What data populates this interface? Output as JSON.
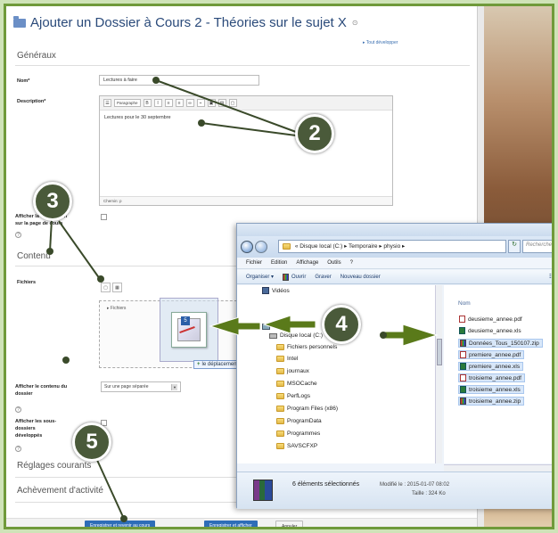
{
  "page": {
    "title": "Ajouter un Dossier à Cours 2 - Théories sur le sujet X",
    "expand_all": "▸ Tout développer",
    "section_general": "Généraux",
    "section_content": "Contenu",
    "section_restrictions": "Réglages courants",
    "section_completion": "Achèvement d'activité"
  },
  "form": {
    "name_label": "Nom*",
    "name_value": "Lectures à faire",
    "description_label": "Description*",
    "editor_paragraph": "Paragraphe",
    "description_value": "Lectures pour le 30 septembre",
    "editor_path": "Chemin: p",
    "show_description_label": "Afficher la description sur la page de cours",
    "files_label": "Fichiers",
    "files_tree": "▸ Fichiers",
    "display_label": "Afficher le contenu du dossier",
    "display_value": "Sur une page séparée",
    "expand_sub_label": "Afficher les sous-dossiers développés"
  },
  "drag": {
    "tooltip": "le déplacement",
    "badge": "5"
  },
  "buttons": {
    "save_return": "Enregistrer et revenir au cours",
    "save_display": "Enregistrer et afficher",
    "cancel": "Annuler"
  },
  "explorer": {
    "path": "« Disque local (C:) ▸ Temporaire ▸ physio ▸",
    "search_placeholder": "Rechercher",
    "menu": [
      "Fichier",
      "Edition",
      "Affichage",
      "Outils",
      "?"
    ],
    "commands": [
      "Organiser ▾",
      "Ouvrir",
      "Graver",
      "Nouveau dossier"
    ],
    "column_name": "Nom",
    "nav_items": [
      "Vidéos",
      "Ordinateur",
      "Disque local (C:)",
      "Fichiers personnels",
      "Intel",
      "journaux",
      "MSOCache",
      "PerfLogs",
      "Program Files (x86)",
      "ProgramData",
      "Programmes",
      "SAVSCFXP"
    ],
    "files": [
      {
        "name": "deusieme_annee.pdf",
        "type": "pdf",
        "selected": false
      },
      {
        "name": "deusieme_annee.xls",
        "type": "xls",
        "selected": false
      },
      {
        "name": "Données_Tous_150107.zip",
        "type": "zip",
        "selected": true
      },
      {
        "name": "premiere_annee.pdf",
        "type": "pdf",
        "selected": true
      },
      {
        "name": "premiere_annee.xls",
        "type": "xls",
        "selected": true
      },
      {
        "name": "troisieme_annee.pdf",
        "type": "pdf",
        "selected": true
      },
      {
        "name": "troisieme_annee.xls",
        "type": "xls",
        "selected": true
      },
      {
        "name": "troisieme_annee.zip",
        "type": "zip",
        "selected": true
      }
    ],
    "status_count": "6 éléments sélectionnés",
    "status_modified": "Modifié le : 2015-01-07 08:02",
    "status_size": "Taille : 324 Ko"
  },
  "annotations": {
    "step2": "2",
    "step3": "3",
    "step4": "4",
    "step5": "5"
  },
  "colors": {
    "frame": "#6f9a3a",
    "annotation_circle": "#4a5a3a",
    "arrow": "#5a7a1a",
    "primary_button": "#2e6db8"
  }
}
